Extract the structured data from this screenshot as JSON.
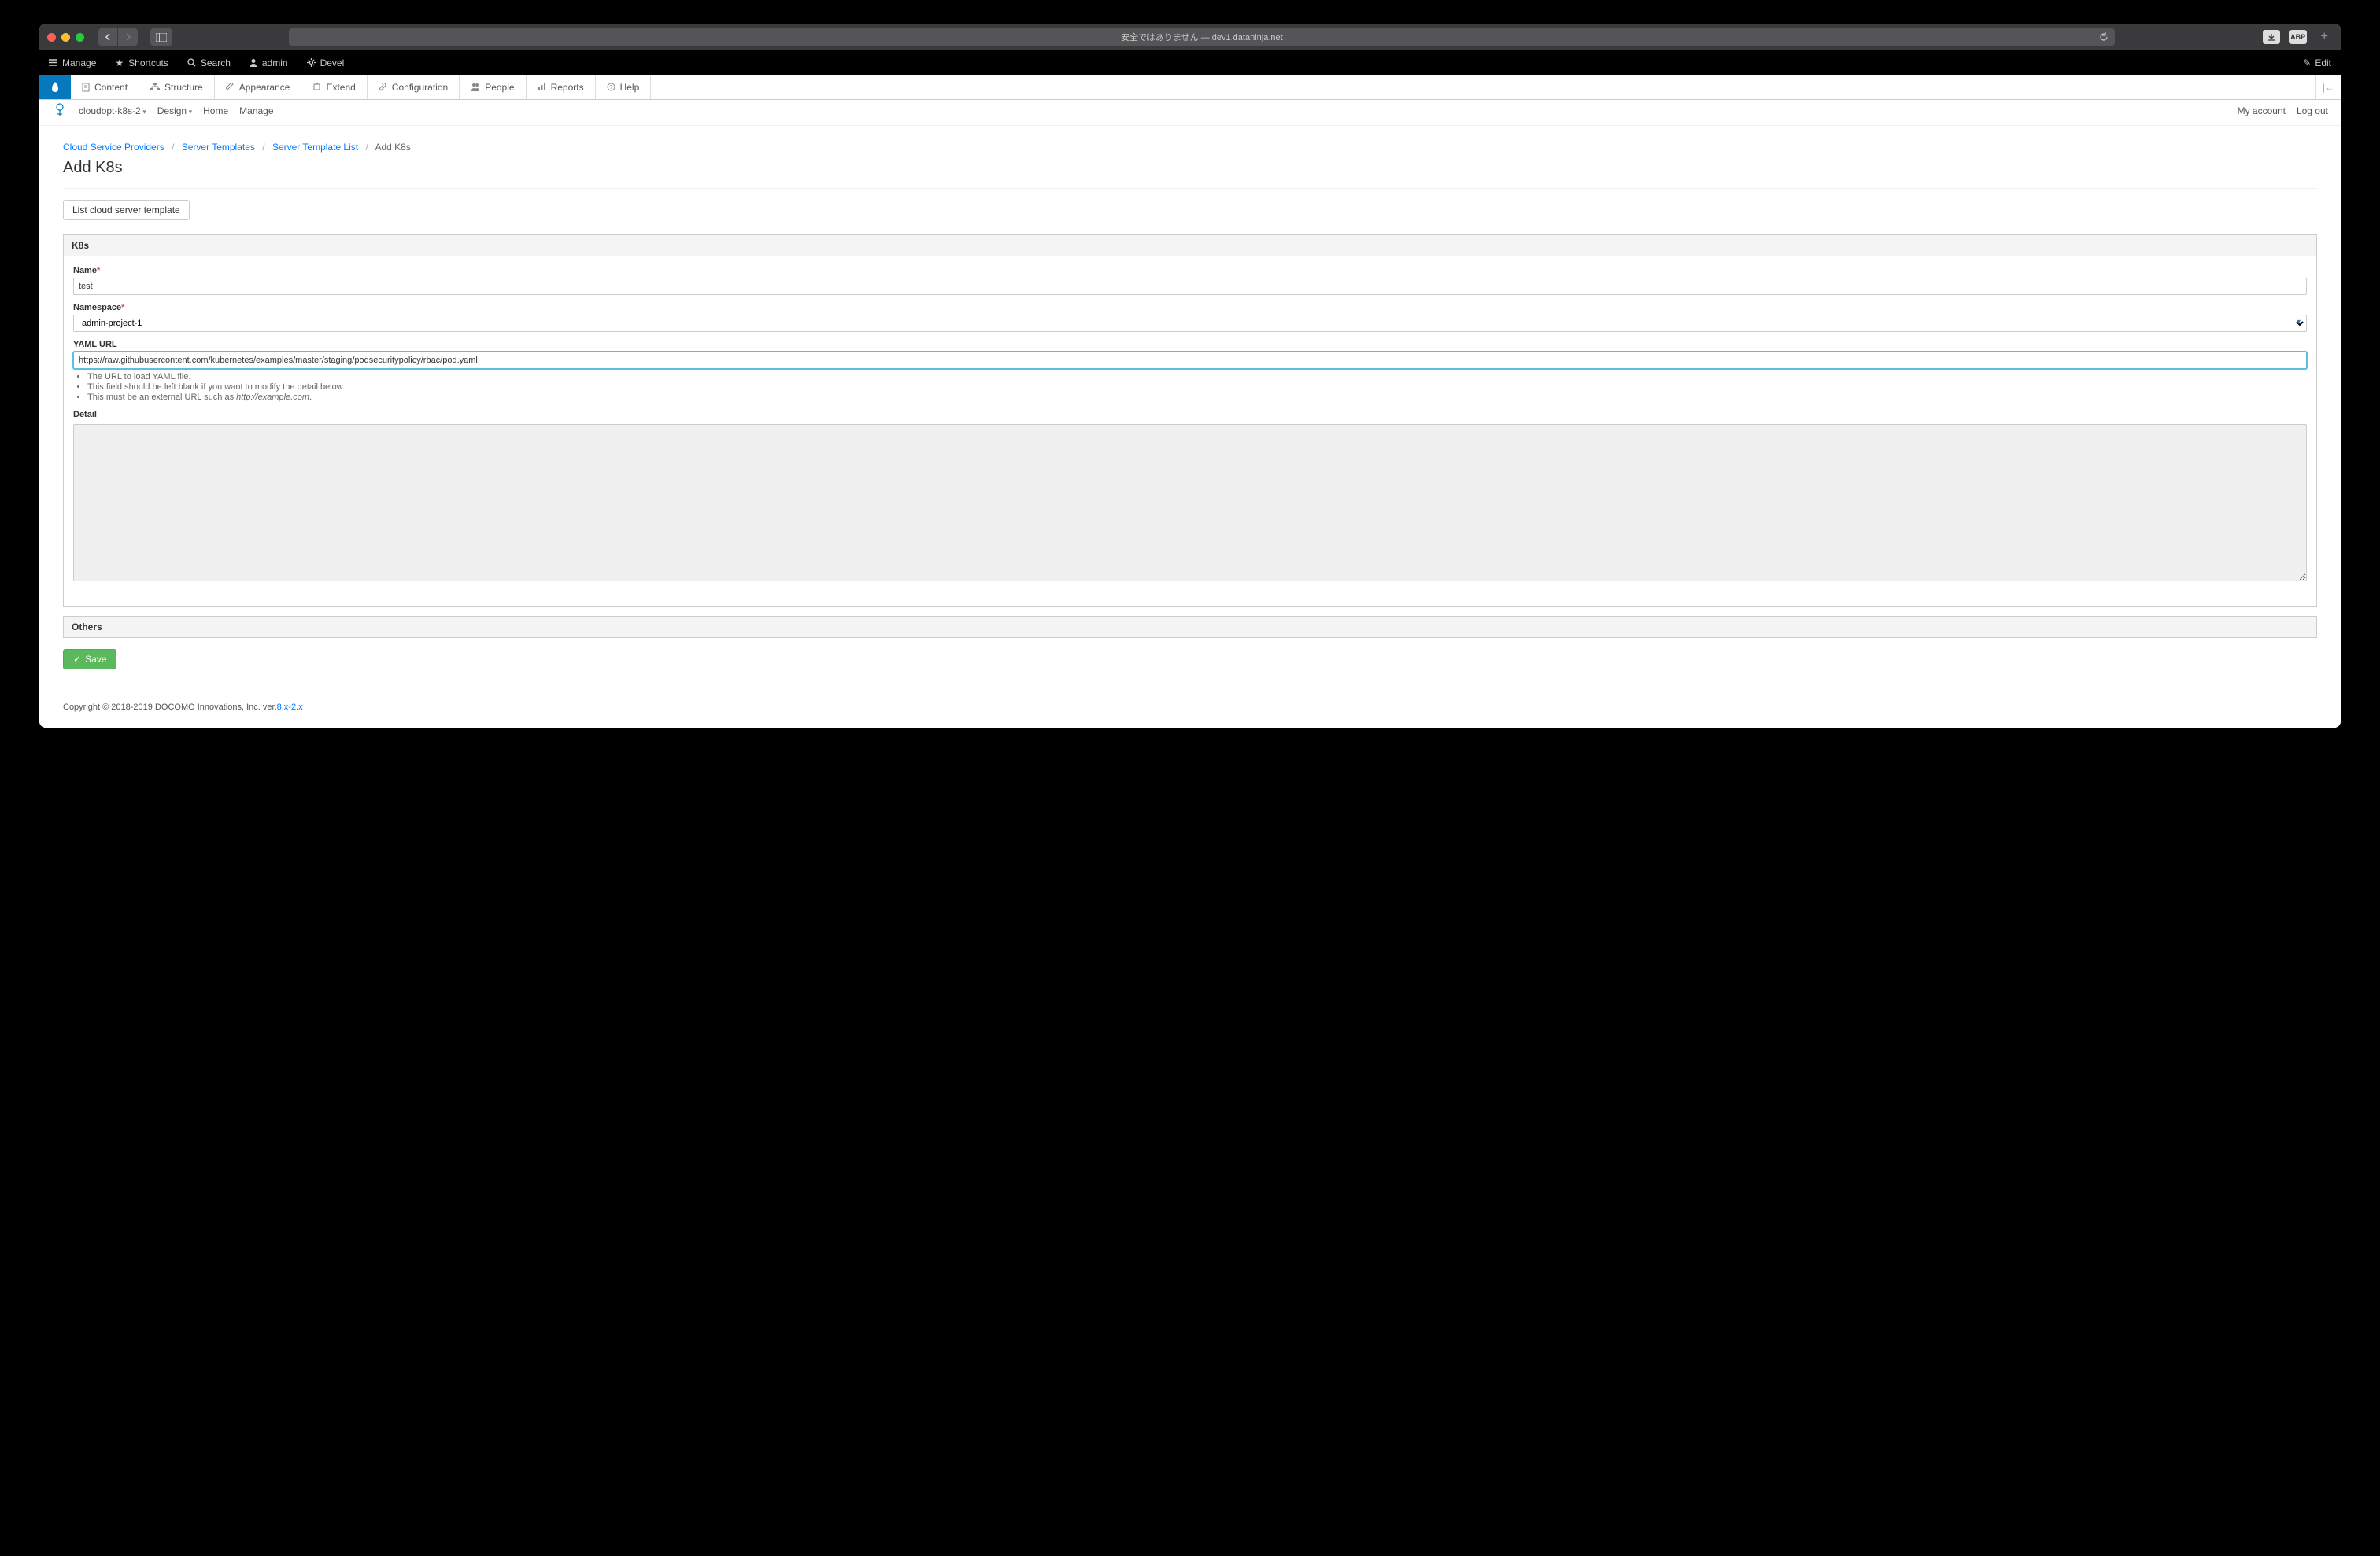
{
  "browser": {
    "url_display": "安全ではありません — dev1.dataninja.net",
    "ext_badge": "ABP"
  },
  "toolbar_black": {
    "manage": "Manage",
    "shortcuts": "Shortcuts",
    "search": "Search",
    "admin": "admin",
    "devel": "Devel",
    "edit": "Edit"
  },
  "toolbar_white": {
    "content": "Content",
    "structure": "Structure",
    "appearance": "Appearance",
    "extend": "Extend",
    "configuration": "Configuration",
    "people": "People",
    "reports": "Reports",
    "help": "Help"
  },
  "site_nav": {
    "brand": "cloudopt-k8s-2",
    "design": "Design",
    "home": "Home",
    "manage": "Manage",
    "my_account": "My account",
    "logout": "Log out"
  },
  "breadcrumbs": {
    "csp": "Cloud Service Providers",
    "server_templates": "Server Templates",
    "server_template_list": "Server Template List",
    "current": "Add K8s"
  },
  "page": {
    "title": "Add K8s",
    "list_button": "List cloud server template"
  },
  "form": {
    "section_k8s": "K8s",
    "name_label": "Name",
    "name_value": "test",
    "namespace_label": "Namespace",
    "namespace_value": "admin-project-1",
    "yaml_label": "YAML URL",
    "yaml_value": "https://raw.githubusercontent.com/kubernetes/examples/master/staging/podsecuritypolicy/rbac/pod.yaml",
    "help1": "The URL to load YAML file.",
    "help2": "This field should be left blank if you want to modify the detail below.",
    "help3_prefix": "This must be an external URL such as ",
    "help3_em": "http://example.com",
    "detail_label": "Detail",
    "detail_value": "",
    "section_others": "Others",
    "save": "Save"
  },
  "footer": {
    "text": "Copyright © 2018-2019 DOCOMO Innovations, Inc. ver.",
    "version": "8.x-2.x"
  }
}
